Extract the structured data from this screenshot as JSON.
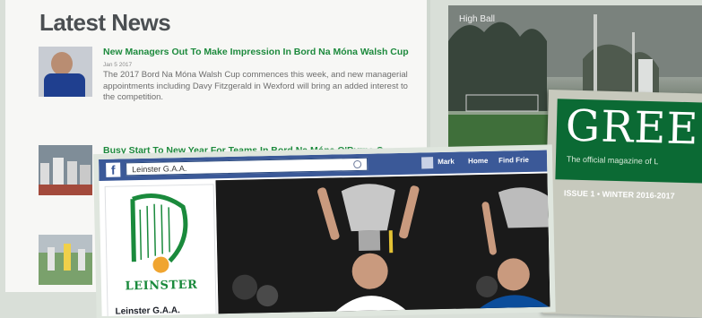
{
  "news": {
    "heading": "Latest News",
    "items": [
      {
        "headline": "New Managers Out To Make Impression In Bord Na Móna Walsh Cup",
        "date": "Jan 5 2017",
        "excerpt": "The 2017 Bord Na Móna Walsh Cup commences this week, and new managerial appointments including Davy Fitzgerald in Wexford will bring an added interest to the competition."
      },
      {
        "headline": "Busy Start To New Year For Teams In Bord Na Móna O'Byrne Cup",
        "date": "",
        "excerpt": ""
      },
      {
        "headline": "",
        "date": "",
        "excerpt": ""
      }
    ]
  },
  "hero_photo": {
    "caption": "High Ball"
  },
  "magazine": {
    "title": "GREE",
    "tagline": "The official magazine of L",
    "issue": "ISSUE 1 • WINTER 2016-2017"
  },
  "facebook": {
    "logo": "f",
    "search_value": "Leinster G.A.A.",
    "nav": {
      "profile": "Mark",
      "home": "Home",
      "find_friends": "Find Frie"
    },
    "crest_text": "LEINSTER",
    "page_name": "Leinster G.A.A."
  },
  "colors": {
    "news_green": "#1d8a3d",
    "facebook_blue": "#3b5998",
    "magazine_green": "#0b6a34"
  }
}
